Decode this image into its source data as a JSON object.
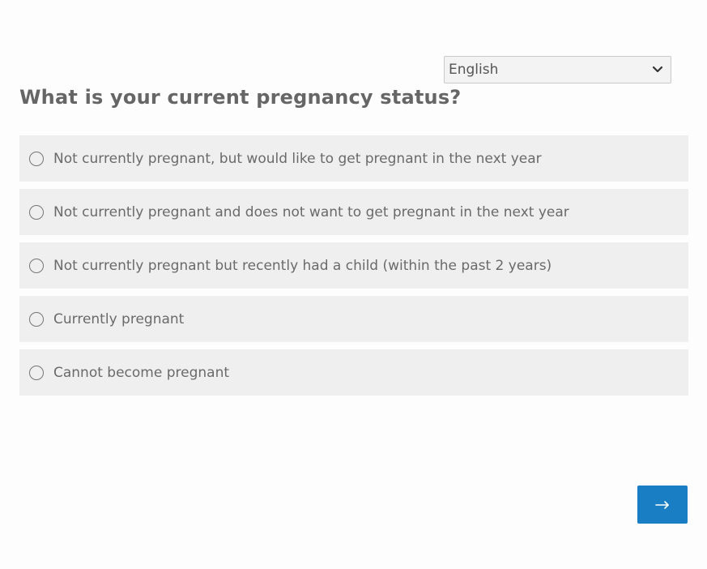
{
  "language_select": {
    "selected": "English",
    "icon": "chevron-down-icon"
  },
  "question": {
    "title": "What is your current pregnancy status?"
  },
  "options": [
    {
      "label": "Not currently pregnant, but would like to get pregnant in the next year",
      "selected": false
    },
    {
      "label": "Not currently pregnant and does not want to get pregnant in the next year",
      "selected": false
    },
    {
      "label": "Not currently pregnant but recently had a child (within the past 2 years)",
      "selected": false
    },
    {
      "label": "Currently pregnant",
      "selected": false
    },
    {
      "label": "Cannot become pregnant",
      "selected": false
    }
  ],
  "next_button": {
    "icon": "arrow-right-icon"
  },
  "colors": {
    "accent": "#1a7ec4",
    "option_background": "#efefef",
    "title_text": "#666666"
  }
}
